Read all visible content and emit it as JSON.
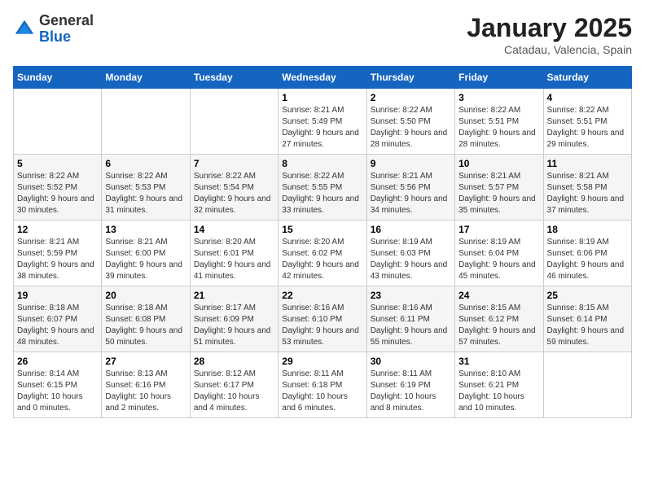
{
  "header": {
    "logo": {
      "general": "General",
      "blue": "Blue"
    },
    "title": "January 2025",
    "location": "Catadau, Valencia, Spain"
  },
  "weekdays": [
    "Sunday",
    "Monday",
    "Tuesday",
    "Wednesday",
    "Thursday",
    "Friday",
    "Saturday"
  ],
  "weeks": [
    [
      {
        "day": "",
        "info": ""
      },
      {
        "day": "",
        "info": ""
      },
      {
        "day": "",
        "info": ""
      },
      {
        "day": "1",
        "info": "Sunrise: 8:21 AM\nSunset: 5:49 PM\nDaylight: 9 hours and 27 minutes."
      },
      {
        "day": "2",
        "info": "Sunrise: 8:22 AM\nSunset: 5:50 PM\nDaylight: 9 hours and 28 minutes."
      },
      {
        "day": "3",
        "info": "Sunrise: 8:22 AM\nSunset: 5:51 PM\nDaylight: 9 hours and 28 minutes."
      },
      {
        "day": "4",
        "info": "Sunrise: 8:22 AM\nSunset: 5:51 PM\nDaylight: 9 hours and 29 minutes."
      }
    ],
    [
      {
        "day": "5",
        "info": "Sunrise: 8:22 AM\nSunset: 5:52 PM\nDaylight: 9 hours and 30 minutes."
      },
      {
        "day": "6",
        "info": "Sunrise: 8:22 AM\nSunset: 5:53 PM\nDaylight: 9 hours and 31 minutes."
      },
      {
        "day": "7",
        "info": "Sunrise: 8:22 AM\nSunset: 5:54 PM\nDaylight: 9 hours and 32 minutes."
      },
      {
        "day": "8",
        "info": "Sunrise: 8:22 AM\nSunset: 5:55 PM\nDaylight: 9 hours and 33 minutes."
      },
      {
        "day": "9",
        "info": "Sunrise: 8:21 AM\nSunset: 5:56 PM\nDaylight: 9 hours and 34 minutes."
      },
      {
        "day": "10",
        "info": "Sunrise: 8:21 AM\nSunset: 5:57 PM\nDaylight: 9 hours and 35 minutes."
      },
      {
        "day": "11",
        "info": "Sunrise: 8:21 AM\nSunset: 5:58 PM\nDaylight: 9 hours and 37 minutes."
      }
    ],
    [
      {
        "day": "12",
        "info": "Sunrise: 8:21 AM\nSunset: 5:59 PM\nDaylight: 9 hours and 38 minutes."
      },
      {
        "day": "13",
        "info": "Sunrise: 8:21 AM\nSunset: 6:00 PM\nDaylight: 9 hours and 39 minutes."
      },
      {
        "day": "14",
        "info": "Sunrise: 8:20 AM\nSunset: 6:01 PM\nDaylight: 9 hours and 41 minutes."
      },
      {
        "day": "15",
        "info": "Sunrise: 8:20 AM\nSunset: 6:02 PM\nDaylight: 9 hours and 42 minutes."
      },
      {
        "day": "16",
        "info": "Sunrise: 8:19 AM\nSunset: 6:03 PM\nDaylight: 9 hours and 43 minutes."
      },
      {
        "day": "17",
        "info": "Sunrise: 8:19 AM\nSunset: 6:04 PM\nDaylight: 9 hours and 45 minutes."
      },
      {
        "day": "18",
        "info": "Sunrise: 8:19 AM\nSunset: 6:06 PM\nDaylight: 9 hours and 46 minutes."
      }
    ],
    [
      {
        "day": "19",
        "info": "Sunrise: 8:18 AM\nSunset: 6:07 PM\nDaylight: 9 hours and 48 minutes."
      },
      {
        "day": "20",
        "info": "Sunrise: 8:18 AM\nSunset: 6:08 PM\nDaylight: 9 hours and 50 minutes."
      },
      {
        "day": "21",
        "info": "Sunrise: 8:17 AM\nSunset: 6:09 PM\nDaylight: 9 hours and 51 minutes."
      },
      {
        "day": "22",
        "info": "Sunrise: 8:16 AM\nSunset: 6:10 PM\nDaylight: 9 hours and 53 minutes."
      },
      {
        "day": "23",
        "info": "Sunrise: 8:16 AM\nSunset: 6:11 PM\nDaylight: 9 hours and 55 minutes."
      },
      {
        "day": "24",
        "info": "Sunrise: 8:15 AM\nSunset: 6:12 PM\nDaylight: 9 hours and 57 minutes."
      },
      {
        "day": "25",
        "info": "Sunrise: 8:15 AM\nSunset: 6:14 PM\nDaylight: 9 hours and 59 minutes."
      }
    ],
    [
      {
        "day": "26",
        "info": "Sunrise: 8:14 AM\nSunset: 6:15 PM\nDaylight: 10 hours and 0 minutes."
      },
      {
        "day": "27",
        "info": "Sunrise: 8:13 AM\nSunset: 6:16 PM\nDaylight: 10 hours and 2 minutes."
      },
      {
        "day": "28",
        "info": "Sunrise: 8:12 AM\nSunset: 6:17 PM\nDaylight: 10 hours and 4 minutes."
      },
      {
        "day": "29",
        "info": "Sunrise: 8:11 AM\nSunset: 6:18 PM\nDaylight: 10 hours and 6 minutes."
      },
      {
        "day": "30",
        "info": "Sunrise: 8:11 AM\nSunset: 6:19 PM\nDaylight: 10 hours and 8 minutes."
      },
      {
        "day": "31",
        "info": "Sunrise: 8:10 AM\nSunset: 6:21 PM\nDaylight: 10 hours and 10 minutes."
      },
      {
        "day": "",
        "info": ""
      }
    ]
  ]
}
